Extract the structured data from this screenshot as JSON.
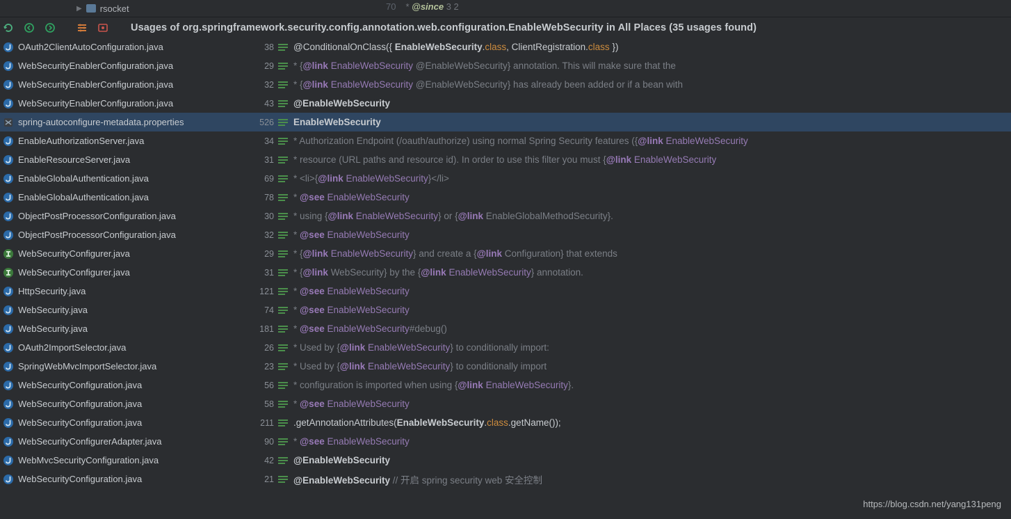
{
  "tree": {
    "folder": "rsocket"
  },
  "editor": {
    "lineNum": "70",
    "tag": "@since",
    "after": " 3 2"
  },
  "title": "Usages of org.springframework.security.config.annotation.web.configuration.EnableWebSecurity in All Places (35 usages found)",
  "watermark": "https://blog.csdn.net/yang131peng",
  "rows": [
    {
      "icon": "java",
      "file": "OAuth2ClientAutoConfiguration.java",
      "line": "38",
      "sel": false,
      "segs": [
        {
          "t": "@ConditionalOnClass({ ",
          "c": "plain"
        },
        {
          "t": "EnableWebSecurity",
          "c": "bold"
        },
        {
          "t": ".",
          "c": "plain"
        },
        {
          "t": "class",
          "c": "key"
        },
        {
          "t": ", ClientRegistration.",
          "c": "plain"
        },
        {
          "t": "class",
          "c": "key"
        },
        {
          "t": " })",
          "c": "plain"
        }
      ]
    },
    {
      "icon": "java",
      "file": "WebSecurityEnablerConfiguration.java",
      "line": "29",
      "sel": false,
      "segs": [
        {
          "t": "* {",
          "c": "dim"
        },
        {
          "t": "@link",
          "c": "link"
        },
        {
          "t": " ",
          "c": "dim"
        },
        {
          "t": "EnableWebSecurity",
          "c": "type"
        },
        {
          "t": " @EnableWebSecurity} annotation. This will make sure that the",
          "c": "dim"
        }
      ]
    },
    {
      "icon": "java",
      "file": "WebSecurityEnablerConfiguration.java",
      "line": "32",
      "sel": false,
      "segs": [
        {
          "t": "* {",
          "c": "dim"
        },
        {
          "t": "@link",
          "c": "link"
        },
        {
          "t": " ",
          "c": "dim"
        },
        {
          "t": "EnableWebSecurity",
          "c": "type"
        },
        {
          "t": " @EnableWebSecurity} has already been added or if a bean with",
          "c": "dim"
        }
      ]
    },
    {
      "icon": "java",
      "file": "WebSecurityEnablerConfiguration.java",
      "line": "43",
      "sel": false,
      "segs": [
        {
          "t": "@",
          "c": "bold"
        },
        {
          "t": "EnableWebSecurity",
          "c": "bold"
        }
      ]
    },
    {
      "icon": "prop",
      "file": "spring-autoconfigure-metadata.properties",
      "line": "526",
      "sel": true,
      "segs": [
        {
          "t": "EnableWebSecurity",
          "c": "bold"
        }
      ]
    },
    {
      "icon": "java",
      "file": "EnableAuthorizationServer.java",
      "line": "34",
      "sel": false,
      "segs": [
        {
          "t": "* Authorization Endpoint (/oauth/authorize) using normal Spring Security features ({",
          "c": "dim"
        },
        {
          "t": "@link",
          "c": "link"
        },
        {
          "t": " ",
          "c": "dim"
        },
        {
          "t": "EnableWebSecurity",
          "c": "type"
        }
      ]
    },
    {
      "icon": "java",
      "file": "EnableResourceServer.java",
      "line": "31",
      "sel": false,
      "segs": [
        {
          "t": "* resource (URL paths and resource id). In order to use this filter you must {",
          "c": "dim"
        },
        {
          "t": "@link",
          "c": "link"
        },
        {
          "t": " ",
          "c": "dim"
        },
        {
          "t": "EnableWebSecurity",
          "c": "type"
        }
      ]
    },
    {
      "icon": "java",
      "file": "EnableGlobalAuthentication.java",
      "line": "69",
      "sel": false,
      "segs": [
        {
          "t": "* <li>{",
          "c": "dim"
        },
        {
          "t": "@link",
          "c": "link"
        },
        {
          "t": " ",
          "c": "dim"
        },
        {
          "t": "EnableWebSecurity",
          "c": "type"
        },
        {
          "t": "}</li>",
          "c": "dim"
        }
      ]
    },
    {
      "icon": "java",
      "file": "EnableGlobalAuthentication.java",
      "line": "78",
      "sel": false,
      "segs": [
        {
          "t": "* ",
          "c": "dim"
        },
        {
          "t": "@see",
          "c": "link"
        },
        {
          "t": " ",
          "c": "dim"
        },
        {
          "t": "EnableWebSecurity",
          "c": "type"
        }
      ]
    },
    {
      "icon": "java",
      "file": "ObjectPostProcessorConfiguration.java",
      "line": "30",
      "sel": false,
      "segs": [
        {
          "t": "* using {",
          "c": "dim"
        },
        {
          "t": "@link",
          "c": "link"
        },
        {
          "t": " ",
          "c": "dim"
        },
        {
          "t": "EnableWebSecurity",
          "c": "type"
        },
        {
          "t": "} or {",
          "c": "dim"
        },
        {
          "t": "@link",
          "c": "link"
        },
        {
          "t": " EnableGlobalMethodSecurity}.",
          "c": "dim"
        }
      ]
    },
    {
      "icon": "java",
      "file": "ObjectPostProcessorConfiguration.java",
      "line": "32",
      "sel": false,
      "segs": [
        {
          "t": "* ",
          "c": "dim"
        },
        {
          "t": "@see",
          "c": "link"
        },
        {
          "t": " ",
          "c": "dim"
        },
        {
          "t": "EnableWebSecurity",
          "c": "type"
        }
      ]
    },
    {
      "icon": "iface",
      "file": "WebSecurityConfigurer.java",
      "line": "29",
      "sel": false,
      "segs": [
        {
          "t": "* {",
          "c": "dim"
        },
        {
          "t": "@link",
          "c": "link"
        },
        {
          "t": " ",
          "c": "dim"
        },
        {
          "t": "EnableWebSecurity",
          "c": "type"
        },
        {
          "t": "} and create a {",
          "c": "dim"
        },
        {
          "t": "@link",
          "c": "link"
        },
        {
          "t": " Configuration} that extends",
          "c": "dim"
        }
      ]
    },
    {
      "icon": "iface",
      "file": "WebSecurityConfigurer.java",
      "line": "31",
      "sel": false,
      "segs": [
        {
          "t": "* {",
          "c": "dim"
        },
        {
          "t": "@link",
          "c": "link"
        },
        {
          "t": " WebSecurity} by the {",
          "c": "dim"
        },
        {
          "t": "@link",
          "c": "link"
        },
        {
          "t": " ",
          "c": "dim"
        },
        {
          "t": "EnableWebSecurity",
          "c": "type"
        },
        {
          "t": "} annotation.",
          "c": "dim"
        }
      ]
    },
    {
      "icon": "java",
      "file": "HttpSecurity.java",
      "line": "121",
      "sel": false,
      "segs": [
        {
          "t": "* ",
          "c": "dim"
        },
        {
          "t": "@see",
          "c": "link"
        },
        {
          "t": " ",
          "c": "dim"
        },
        {
          "t": "EnableWebSecurity",
          "c": "type"
        }
      ]
    },
    {
      "icon": "java",
      "file": "WebSecurity.java",
      "line": "74",
      "sel": false,
      "segs": [
        {
          "t": "* ",
          "c": "dim"
        },
        {
          "t": "@see",
          "c": "link"
        },
        {
          "t": " ",
          "c": "dim"
        },
        {
          "t": "EnableWebSecurity",
          "c": "type"
        }
      ]
    },
    {
      "icon": "java",
      "file": "WebSecurity.java",
      "line": "181",
      "sel": false,
      "segs": [
        {
          "t": "* ",
          "c": "dim"
        },
        {
          "t": "@see",
          "c": "link"
        },
        {
          "t": " ",
          "c": "dim"
        },
        {
          "t": "EnableWebSecurity",
          "c": "type"
        },
        {
          "t": "#debug()",
          "c": "dim"
        }
      ]
    },
    {
      "icon": "java",
      "file": "OAuth2ImportSelector.java",
      "line": "26",
      "sel": false,
      "segs": [
        {
          "t": "* Used by {",
          "c": "dim"
        },
        {
          "t": "@link",
          "c": "link"
        },
        {
          "t": " ",
          "c": "dim"
        },
        {
          "t": "EnableWebSecurity",
          "c": "type"
        },
        {
          "t": "} to conditionally import:",
          "c": "dim"
        }
      ]
    },
    {
      "icon": "java",
      "file": "SpringWebMvcImportSelector.java",
      "line": "23",
      "sel": false,
      "segs": [
        {
          "t": "* Used by {",
          "c": "dim"
        },
        {
          "t": "@link",
          "c": "link"
        },
        {
          "t": " ",
          "c": "dim"
        },
        {
          "t": "EnableWebSecurity",
          "c": "type"
        },
        {
          "t": "} to conditionally import",
          "c": "dim"
        }
      ]
    },
    {
      "icon": "java",
      "file": "WebSecurityConfiguration.java",
      "line": "56",
      "sel": false,
      "segs": [
        {
          "t": "* configuration is imported when using {",
          "c": "dim"
        },
        {
          "t": "@link",
          "c": "link"
        },
        {
          "t": " ",
          "c": "dim"
        },
        {
          "t": "EnableWebSecurity",
          "c": "type"
        },
        {
          "t": "}.",
          "c": "dim"
        }
      ]
    },
    {
      "icon": "java",
      "file": "WebSecurityConfiguration.java",
      "line": "58",
      "sel": false,
      "segs": [
        {
          "t": "* ",
          "c": "dim"
        },
        {
          "t": "@see",
          "c": "link"
        },
        {
          "t": " ",
          "c": "dim"
        },
        {
          "t": "EnableWebSecurity",
          "c": "type"
        }
      ]
    },
    {
      "icon": "java",
      "file": "WebSecurityConfiguration.java",
      "line": "211",
      "sel": false,
      "segs": [
        {
          "t": ".getAnnotationAttributes(",
          "c": "plain"
        },
        {
          "t": "EnableWebSecurity",
          "c": "bold"
        },
        {
          "t": ".",
          "c": "plain"
        },
        {
          "t": "class",
          "c": "key"
        },
        {
          "t": ".getName());",
          "c": "plain"
        }
      ]
    },
    {
      "icon": "java",
      "file": "WebSecurityConfigurerAdapter.java",
      "line": "90",
      "sel": false,
      "segs": [
        {
          "t": "* ",
          "c": "dim"
        },
        {
          "t": "@see",
          "c": "link"
        },
        {
          "t": " ",
          "c": "dim"
        },
        {
          "t": "EnableWebSecurity",
          "c": "type"
        }
      ]
    },
    {
      "icon": "java",
      "file": "WebMvcSecurityConfiguration.java",
      "line": "42",
      "sel": false,
      "segs": [
        {
          "t": "@",
          "c": "bold"
        },
        {
          "t": "EnableWebSecurity",
          "c": "bold"
        }
      ]
    },
    {
      "icon": "java",
      "file": "WebSecurityConfiguration.java",
      "line": "21",
      "sel": false,
      "segs": [
        {
          "t": "@",
          "c": "bold"
        },
        {
          "t": "EnableWebSecurity",
          "c": "bold"
        },
        {
          "t": " // 开启 spring security web 安全控制",
          "c": "dim"
        }
      ]
    }
  ]
}
